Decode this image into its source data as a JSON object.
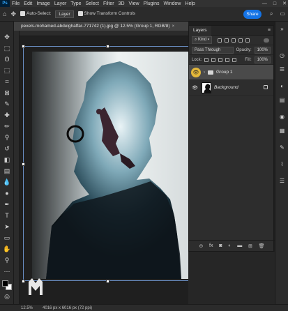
{
  "app": {
    "logo": "Ps"
  },
  "menubar": {
    "items": [
      "File",
      "Edit",
      "Image",
      "Layer",
      "Type",
      "Select",
      "Filter",
      "3D",
      "View",
      "Plugins",
      "Window",
      "Help"
    ],
    "window_controls": [
      "—",
      "□",
      "✕"
    ]
  },
  "options": {
    "auto_select_label": "Auto-Select:",
    "auto_select_value": "Layer",
    "transform_controls_label": "Show Transform Controls",
    "share_label": "Share"
  },
  "document": {
    "tab_title": "pexels-mohamed-abdelghaffar-771742 (1).jpg @ 12.5% (Group 1, RGB/8)",
    "tab_close": "×"
  },
  "layers_panel": {
    "tab_label": "Layers",
    "kind_label": "Kind",
    "blend_mode": "Pass Through",
    "opacity_label": "Opacity:",
    "opacity_value": "100%",
    "lock_label": "Lock:",
    "fill_label": "Fill:",
    "fill_value": "100%",
    "layers": [
      {
        "name": "Group 1",
        "type": "group",
        "selected": true
      },
      {
        "name": "Background",
        "type": "image",
        "locked": true
      }
    ],
    "footer_icons": [
      "link-icon",
      "fx-icon",
      "mask-icon",
      "adjustment-icon",
      "folder-icon",
      "new-layer-icon",
      "trash-icon"
    ]
  },
  "status": {
    "zoom": "12.5%",
    "doc_info": "4016 px x 6016 px (72 ppi)"
  },
  "colors": {
    "accent": "#1473e6",
    "selection_highlight": "#e3b73a",
    "panel_bg": "#2d2d2d"
  }
}
